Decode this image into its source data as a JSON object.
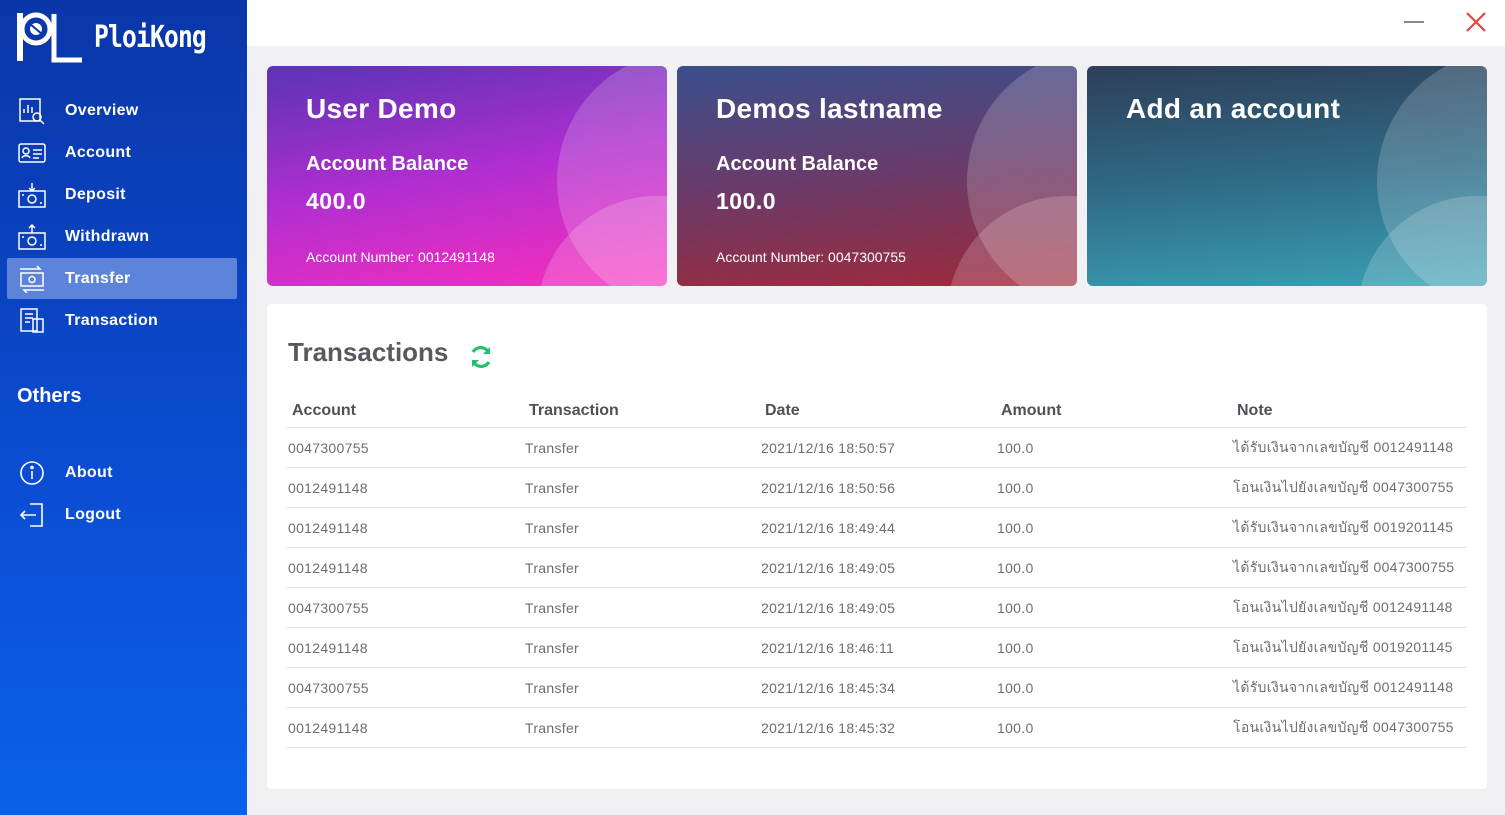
{
  "app": {
    "name": "PloiKong"
  },
  "sidebar": {
    "items": [
      {
        "label": "Overview",
        "icon": "overview-icon"
      },
      {
        "label": "Account",
        "icon": "account-icon"
      },
      {
        "label": "Deposit",
        "icon": "deposit-icon"
      },
      {
        "label": "Withdrawn",
        "icon": "withdraw-icon"
      },
      {
        "label": "Transfer",
        "icon": "transfer-icon",
        "active": true
      },
      {
        "label": "Transaction",
        "icon": "transaction-icon"
      }
    ],
    "others_title": "Others",
    "others": [
      {
        "label": "About",
        "icon": "info-icon"
      },
      {
        "label": "Logout",
        "icon": "logout-icon"
      }
    ]
  },
  "cards": [
    {
      "name": "User Demo",
      "balance_label": "Account Balance",
      "balance": "400.0",
      "account_number": "Account Number: 0012491148"
    },
    {
      "name": "Demos lastname",
      "balance_label": "Account Balance",
      "balance": "100.0",
      "account_number": "Account Number: 0047300755"
    },
    {
      "name": "Add an account"
    }
  ],
  "transactions": {
    "title": "Transactions",
    "columns": [
      "Account",
      "Transaction",
      "Date",
      "Amount",
      "Note"
    ],
    "rows": [
      [
        "0047300755",
        "Transfer",
        "2021/12/16 18:50:57",
        "100.0",
        "ได้รับเงินจากเลขบัญชี 0012491148"
      ],
      [
        "0012491148",
        "Transfer",
        "2021/12/16 18:50:56",
        "100.0",
        "โอนเงินไปยังเลขบัญชี 0047300755"
      ],
      [
        "0012491148",
        "Transfer",
        "2021/12/16 18:49:44",
        "100.0",
        "ได้รับเงินจากเลขบัญชี 0019201145"
      ],
      [
        "0012491148",
        "Transfer",
        "2021/12/16 18:49:05",
        "100.0",
        "ได้รับเงินจากเลขบัญชี 0047300755"
      ],
      [
        "0047300755",
        "Transfer",
        "2021/12/16 18:49:05",
        "100.0",
        "โอนเงินไปยังเลขบัญชี 0012491148"
      ],
      [
        "0012491148",
        "Transfer",
        "2021/12/16 18:46:11",
        "100.0",
        "โอนเงินไปยังเลขบัญชี 0019201145"
      ],
      [
        "0047300755",
        "Transfer",
        "2021/12/16 18:45:34",
        "100.0",
        "ได้รับเงินจากเลขบัญชี 0012491148"
      ],
      [
        "0012491148",
        "Transfer",
        "2021/12/16 18:45:32",
        "100.0",
        "โอนเงินไปยังเลขบัญชี 0047300755"
      ]
    ]
  },
  "colors": {
    "accent_refresh": "#22c06a",
    "close_x": "#e8453c",
    "sidebar": "#0b4bd0"
  }
}
